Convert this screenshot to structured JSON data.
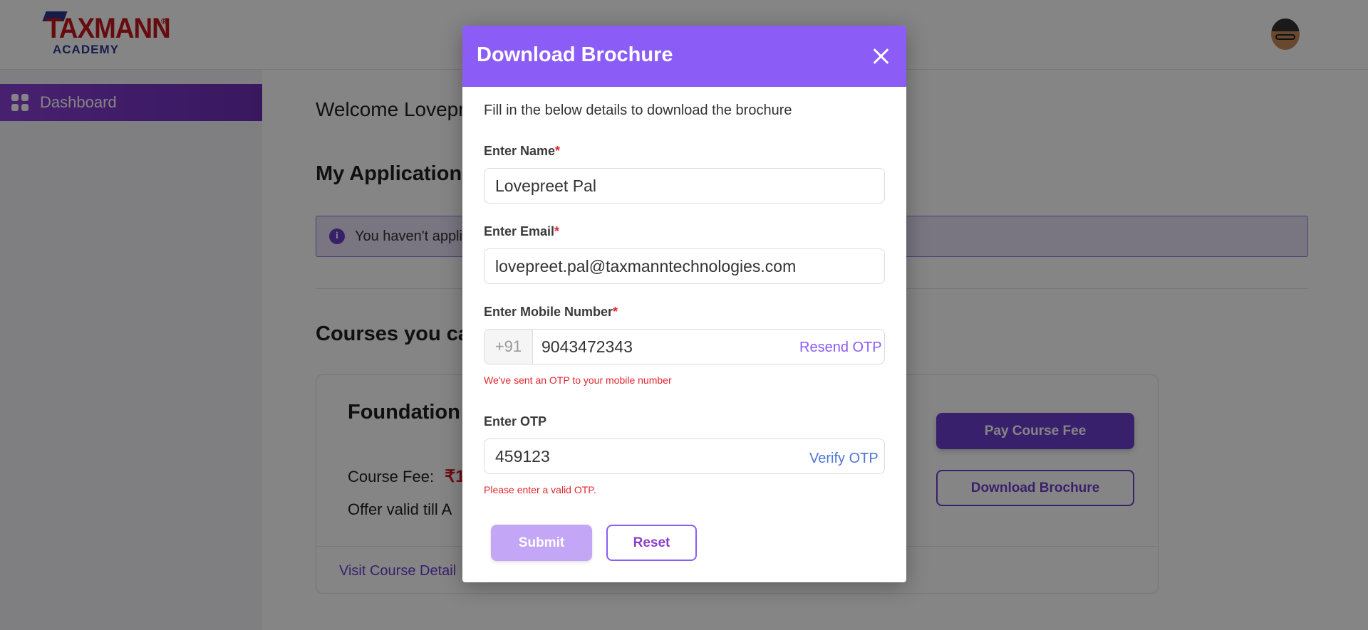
{
  "header": {
    "logo_main": "TAXMANN",
    "logo_reg": "®",
    "logo_sub": "ACADEMY"
  },
  "sidebar": {
    "items": [
      {
        "label": "Dashboard",
        "icon": "grid-icon"
      }
    ]
  },
  "main": {
    "welcome": "Welcome Lovepr",
    "my_applications_title": "My Applications",
    "info_message": "You haven't appli",
    "courses_title": "Courses you can",
    "course": {
      "name": "Foundation",
      "fee_label": "Course Fee:",
      "fee_value": "₹1",
      "offer": "Offer valid till A",
      "pay_button": "Pay Course Fee",
      "download_button": "Download Brochure",
      "visit_link": "Visit Course Detail"
    }
  },
  "modal": {
    "title": "Download Brochure",
    "intro": "Fill in the below details to download the brochure",
    "name_label": "Enter Name",
    "name_value": "Lovepreet Pal",
    "email_label": "Enter Email",
    "email_value": "lovepreet.pal@taxmanntechnologies.com",
    "mobile_label": "Enter Mobile Number",
    "country_code": "+91",
    "mobile_value": "9043472343",
    "resend_otp": "Resend OTP",
    "otp_sent_message": "We've sent an OTP to your mobile number",
    "otp_label": "Enter OTP",
    "otp_value": "459123",
    "verify_otp": "Verify OTP",
    "otp_error": "Please enter a valid OTP.",
    "submit": "Submit",
    "reset": "Reset",
    "required_marker": "*"
  },
  "colors": {
    "accent": "#8b5cf6",
    "primary_button": "#6e3fd0",
    "error": "#e0262e",
    "price": "#d11a2a"
  }
}
